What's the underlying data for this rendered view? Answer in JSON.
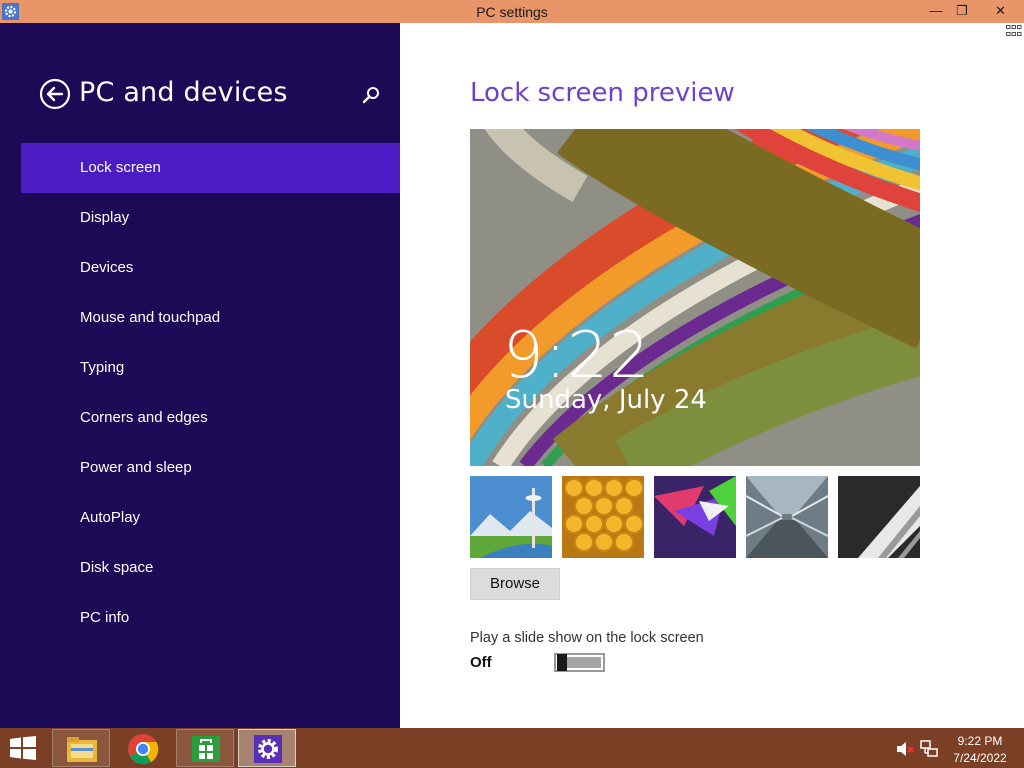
{
  "window": {
    "title": "PC settings",
    "titlebar_color": "#e8956a",
    "minimize_icon": "minimize-icon",
    "maximize_icon": "restore-icon",
    "close_icon": "close-icon",
    "minimize_glyph": "—",
    "restore_glyph": "❐",
    "close_glyph": "✕"
  },
  "sidebar": {
    "title": "PC and devices",
    "background": "#1d0a57",
    "accent": "#4b1cc4",
    "items": [
      {
        "label": "Lock screen",
        "selected": true
      },
      {
        "label": "Display"
      },
      {
        "label": "Devices"
      },
      {
        "label": "Mouse and touchpad"
      },
      {
        "label": "Typing"
      },
      {
        "label": "Corners and edges"
      },
      {
        "label": "Power and sleep"
      },
      {
        "label": "AutoPlay"
      },
      {
        "label": "Disk space"
      },
      {
        "label": "PC info"
      }
    ]
  },
  "main": {
    "section_title": "Lock screen preview",
    "preview_time": "9:22",
    "preview_date": "Sunday, July 24",
    "thumbnails": [
      "seattle-space-needle",
      "honeycomb",
      "purple-geometric",
      "tunnel-motion",
      "piano-keys"
    ],
    "browse_label": "Browse",
    "slideshow_label": "Play a slide show on the lock screen",
    "slideshow_state": "Off"
  },
  "taskbar": {
    "color": "#7a3f24",
    "apps": [
      "file-explorer-icon",
      "chrome-icon",
      "store-icon",
      "settings-icon"
    ],
    "time": "9:22 PM",
    "date": "7/24/2022"
  }
}
